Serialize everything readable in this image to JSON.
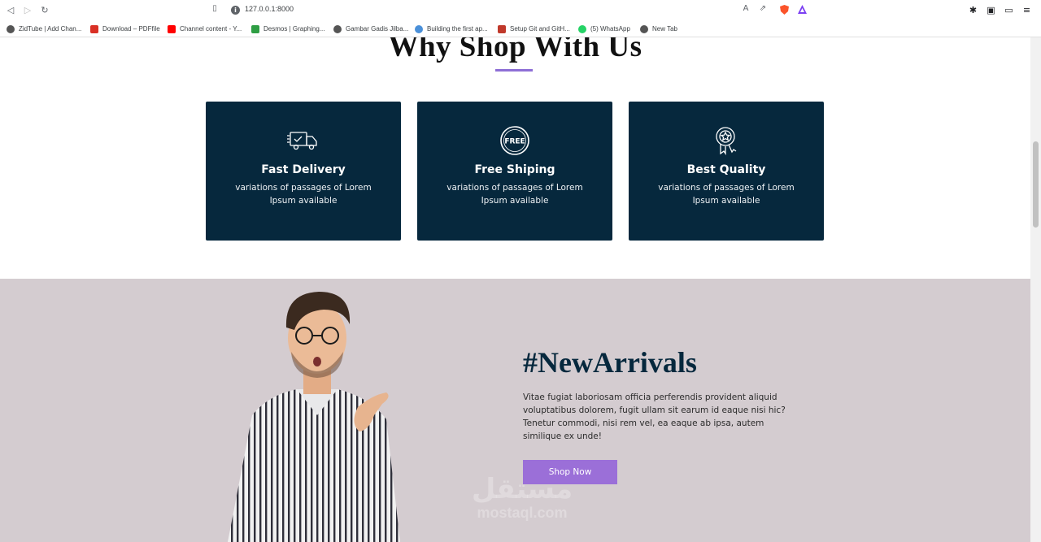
{
  "browser": {
    "url": "127.0.0.1:8000",
    "bookmarks": [
      {
        "label": "ZidTube | Add Chan...",
        "color": "#555555"
      },
      {
        "label": "Download – PDFfile",
        "color": "#d93025"
      },
      {
        "label": "Channel content - Y...",
        "color": "#ff0000"
      },
      {
        "label": "Desmos | Graphing...",
        "color": "#2f9e44"
      },
      {
        "label": "Gambar Gadis Jilba...",
        "color": "#555555"
      },
      {
        "label": "Building the first ap...",
        "color": "#4a90d9"
      },
      {
        "label": "Setup Git and GitH...",
        "color": "#c0392b"
      },
      {
        "label": "(5) WhatsApp",
        "color": "#25d366"
      },
      {
        "label": "New Tab",
        "color": "#555555"
      }
    ]
  },
  "why": {
    "title": "Why Shop With Us",
    "accent": "#8e6fd6",
    "cards": [
      {
        "icon": "truck-icon",
        "title": "Fast Delivery",
        "text": "variations of passages of Lorem Ipsum available"
      },
      {
        "icon": "free-badge-icon",
        "title": "Free Shiping",
        "text": "variations of passages of Lorem Ipsum available"
      },
      {
        "icon": "award-ribbon-icon",
        "title": "Best Quality",
        "text": "variations of passages of Lorem Ipsum available"
      }
    ]
  },
  "arrivals": {
    "title": "#NewArrivals",
    "text": "Vitae fugiat laboriosam officia perferendis provident aliquid voluptatibus dolorem, fugit ullam sit earum id eaque nisi hic? Tenetur commodi, nisi rem vel, ea eaque ab ipsa, autem similique ex unde!",
    "button": "Shop Now",
    "background": "#d4ccd0",
    "button_color": "#9b6fd8"
  },
  "watermark": {
    "arabic": "مستقل",
    "latin": "mostaql.com"
  },
  "colors": {
    "card_bg": "#06283d",
    "heading": "#06283d"
  }
}
